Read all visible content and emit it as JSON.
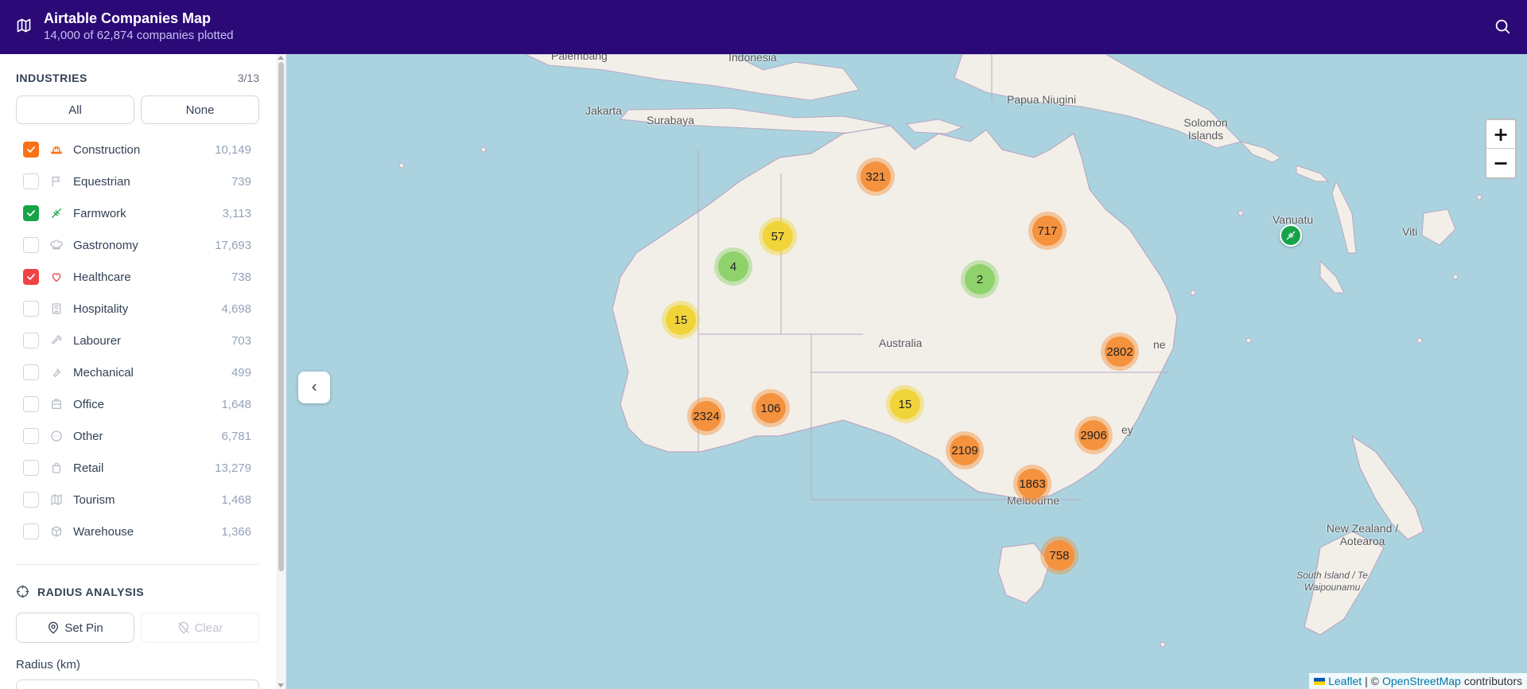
{
  "header": {
    "title": "Airtable Companies Map",
    "subtitle": "14,000 of 62,874 companies plotted"
  },
  "industries": {
    "label": "INDUSTRIES",
    "count": "3/13",
    "all_label": "All",
    "none_label": "None",
    "items": [
      {
        "name": "Construction",
        "count": "10,149",
        "checked": true,
        "color": "#f97316",
        "icon": "hard-hat-icon"
      },
      {
        "name": "Equestrian",
        "count": "739",
        "checked": false,
        "color": "#9ca3af",
        "icon": "flag-icon"
      },
      {
        "name": "Farmwork",
        "count": "3,113",
        "checked": true,
        "color": "#16a34a",
        "icon": "wheat-icon"
      },
      {
        "name": "Gastronomy",
        "count": "17,693",
        "checked": false,
        "color": "#9ca3af",
        "icon": "chef-hat-icon"
      },
      {
        "name": "Healthcare",
        "count": "738",
        "checked": true,
        "color": "#ef4444",
        "icon": "heart-icon"
      },
      {
        "name": "Hospitality",
        "count": "4,698",
        "checked": false,
        "color": "#9ca3af",
        "icon": "hotel-icon"
      },
      {
        "name": "Labourer",
        "count": "703",
        "checked": false,
        "color": "#9ca3af",
        "icon": "hammer-icon"
      },
      {
        "name": "Mechanical",
        "count": "499",
        "checked": false,
        "color": "#9ca3af",
        "icon": "wrench-icon"
      },
      {
        "name": "Office",
        "count": "1,648",
        "checked": false,
        "color": "#9ca3af",
        "icon": "building-icon"
      },
      {
        "name": "Other",
        "count": "6,781",
        "checked": false,
        "color": "#9ca3af",
        "icon": "circle-ellipsis-icon"
      },
      {
        "name": "Retail",
        "count": "13,279",
        "checked": false,
        "color": "#9ca3af",
        "icon": "shopping-bag-icon"
      },
      {
        "name": "Tourism",
        "count": "1,468",
        "checked": false,
        "color": "#9ca3af",
        "icon": "map-icon"
      },
      {
        "name": "Warehouse",
        "count": "1,366",
        "checked": false,
        "color": "#9ca3af",
        "icon": "package-icon"
      }
    ]
  },
  "radius": {
    "label": "RADIUS ANALYSIS",
    "set_pin_label": "Set Pin",
    "clear_label": "Clear",
    "radius_label": "Radius (km)"
  },
  "map": {
    "zoom_in": "+",
    "zoom_out": "−",
    "labels": {
      "palembang": "Palembang",
      "indonesia": "Indonesia",
      "jakarta": "Jakarta",
      "surabaya": "Surabaya",
      "papua": "Papua Niugini",
      "solomon": "Solomon Islands",
      "vanuatu": "Vanuatu",
      "viti": "Viti",
      "australia": "Australia",
      "brisbane_frag": "ne",
      "sydney_frag": "ey",
      "melbourne": "Melbourne",
      "nz": "New Zealand / Aotearoa",
      "south_island": "South Island / Te Waipounamu"
    },
    "clusters": [
      {
        "label": "321",
        "level": "orange"
      },
      {
        "label": "57",
        "level": "yellow"
      },
      {
        "label": "4",
        "level": "green"
      },
      {
        "label": "717",
        "level": "orange"
      },
      {
        "label": "2",
        "level": "green"
      },
      {
        "label": "15",
        "level": "yellow"
      },
      {
        "label": "2802",
        "level": "orange"
      },
      {
        "label": "106",
        "level": "orange"
      },
      {
        "label": "2324",
        "level": "orange"
      },
      {
        "label": "15",
        "level": "yellow"
      },
      {
        "label": "2906",
        "level": "orange"
      },
      {
        "label": "2109",
        "level": "orange"
      },
      {
        "label": "1863",
        "level": "orange"
      },
      {
        "label": "758",
        "level": "orange"
      }
    ],
    "attribution": {
      "leaflet": "Leaflet",
      "sep": "| ©",
      "osm": "OpenStreetMap",
      "contributors": "contributors"
    }
  },
  "colors": {
    "header_bg": "#2b0a77",
    "cluster_orange": "#f5923e",
    "cluster_yellow": "#f0d43a",
    "cluster_green": "#8fd16a"
  }
}
